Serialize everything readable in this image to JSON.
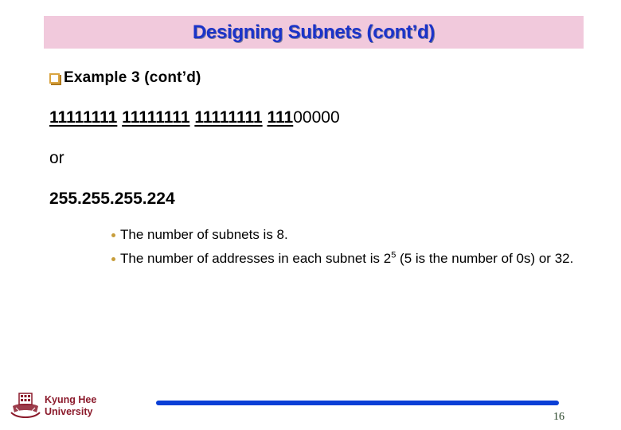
{
  "slide": {
    "title": "Designing Subnets (cont’d)",
    "heading": "Example 3 (cont’d)",
    "binary_mask": {
      "octet1": "11111111",
      "octet2": "11111111",
      "octet3": "11111111",
      "octet4_subnet_bits": "111",
      "octet4_host_bits": "00000"
    },
    "or_text": "or",
    "dotted_mask": "255.255.255.224",
    "bullets": [
      {
        "text": "The number of subnets is 8."
      },
      {
        "text_before_sup": "The number of addresses in each subnet is 2",
        "sup": "5",
        "text_after_sup": " (5 is the number of 0s) or 32."
      }
    ],
    "footer": {
      "logo_line1": "Kyung Hee",
      "logo_line2": "University",
      "page_number": "16"
    }
  },
  "colors": {
    "title_bg": "#f1c9dc",
    "title_text": "#1b33c9",
    "bullet": "#c79d3a",
    "checkbox": "#d9a441",
    "logo": "#8b1a2b",
    "footer_bar": "#0a3fd6"
  }
}
